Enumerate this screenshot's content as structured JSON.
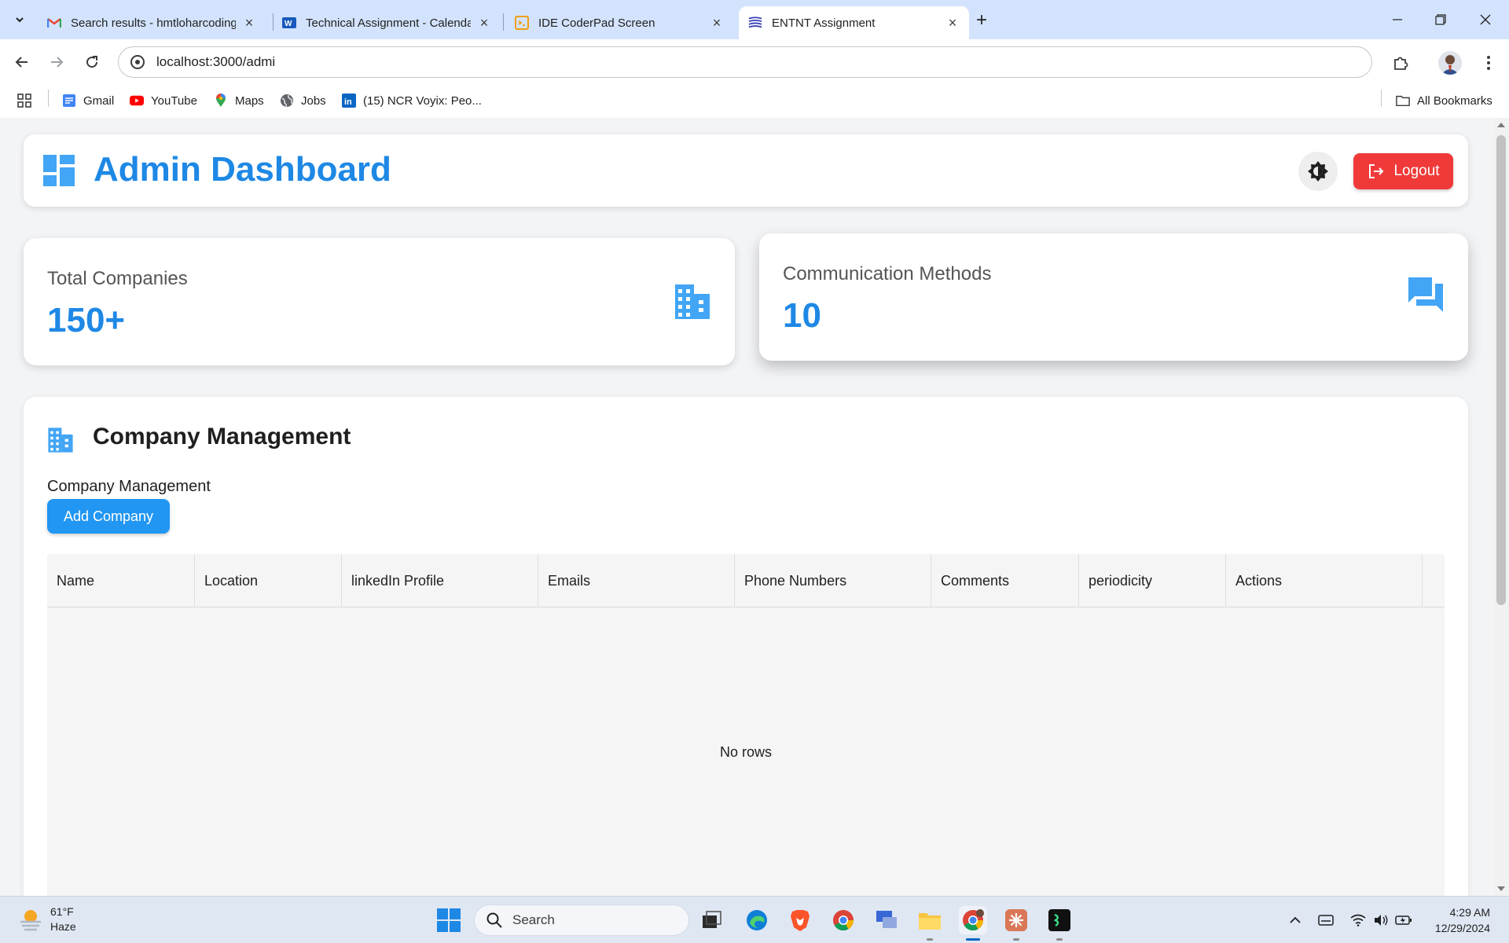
{
  "browser": {
    "tabs": [
      {
        "title": "Search results - hmtloharcoding",
        "favicon": "gmail-icon"
      },
      {
        "title": "Technical Assignment - Calenda",
        "favicon": "word-icon"
      },
      {
        "title": "IDE CoderPad Screen",
        "favicon": "coderpad-icon"
      },
      {
        "title": "ENTNT Assignment",
        "favicon": "entnt-icon",
        "active": true
      }
    ],
    "url": "localhost:3000/admi",
    "bookmarks": [
      {
        "label": "Gmail",
        "icon": "gmail-doc-icon"
      },
      {
        "label": "YouTube",
        "icon": "youtube-icon"
      },
      {
        "label": "Maps",
        "icon": "maps-pin-icon"
      },
      {
        "label": "Jobs",
        "icon": "globe-icon"
      },
      {
        "label": "(15) NCR Voyix: Peo...",
        "icon": "linkedin-icon"
      }
    ],
    "all_bookmarks": "All Bookmarks"
  },
  "header": {
    "title": "Admin Dashboard",
    "logout_label": "Logout"
  },
  "stats": [
    {
      "label": "Total Companies",
      "value": "150+",
      "icon": "building-icon"
    },
    {
      "label": "Communication Methods",
      "value": "10",
      "icon": "forum-icon"
    }
  ],
  "management": {
    "title": "Company Management",
    "subtitle": "Company Management",
    "add_button": "Add Company",
    "columns": [
      "Name",
      "Location",
      "linkedIn Profile",
      "Emails",
      "Phone Numbers",
      "Comments",
      "periodicity",
      "Actions"
    ],
    "rows": [],
    "empty_text": "No rows"
  },
  "taskbar": {
    "weather_temp": "61°F",
    "weather_desc": "Haze",
    "search_placeholder": "Search",
    "time": "4:29 AM",
    "date": "12/29/2024"
  },
  "colors": {
    "accent": "#1e88e5",
    "button_blue": "#2196f3",
    "logout_red": "#f03a3a",
    "tabbar": "#d3e3fd"
  }
}
